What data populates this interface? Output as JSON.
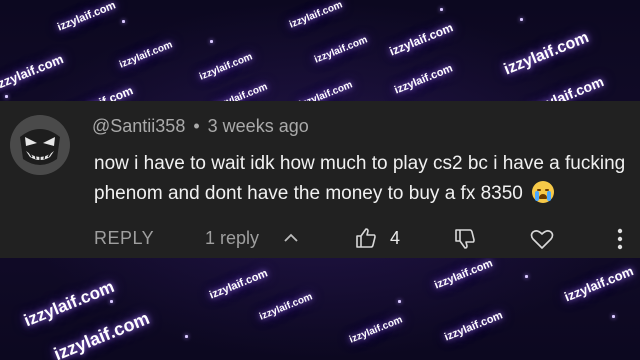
{
  "watermark": {
    "text": "izzylaif.com"
  },
  "comment": {
    "author": "@Santii358",
    "separator": "•",
    "timestamp": "3 weeks ago",
    "body": "now i have to wait idk how much to play cs2 bc i have a fucking phenom and dont have the money to buy a fx 8350",
    "emoji": "loudly-crying-face",
    "actions": {
      "reply_label": "REPLY",
      "replies_label": "1 reply",
      "like_count": "4"
    }
  },
  "colors": {
    "card_bg": "#212121",
    "text": "#f1f1f1",
    "muted": "#aaaaaa",
    "glow": "#b090ff"
  },
  "icons": [
    "chevron-up-icon",
    "thumbs-up-icon",
    "thumbs-down-icon",
    "heart-icon",
    "more-vertical-icon"
  ]
}
